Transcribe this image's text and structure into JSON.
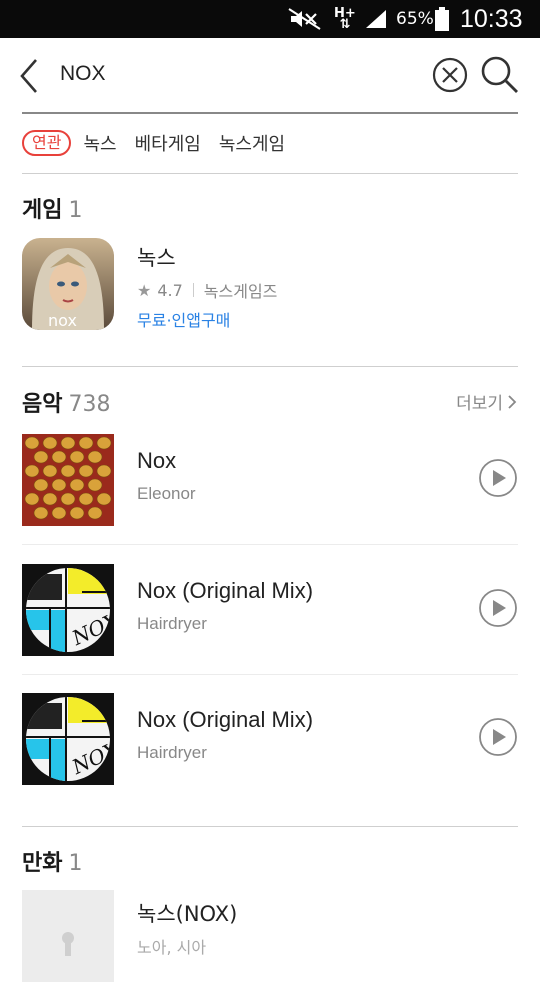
{
  "status_bar": {
    "network": "H+",
    "battery_percent": "65%",
    "time": "10:33"
  },
  "search": {
    "query": "NOX"
  },
  "related": {
    "badge": "연관",
    "tags": [
      "녹스",
      "베타게임",
      "녹스게임"
    ]
  },
  "games": {
    "title": "게임",
    "count": "1",
    "items": [
      {
        "title": "녹스",
        "rating": "4.7",
        "developer": "녹스게임즈",
        "price": "무료·인앱구매",
        "icon_text": "nox"
      }
    ]
  },
  "music": {
    "title": "음악",
    "count": "738",
    "more": "더보기",
    "items": [
      {
        "title": "Nox",
        "artist": "Eleonor"
      },
      {
        "title": "Nox (Original Mix)",
        "artist": "Hairdryer"
      },
      {
        "title": "Nox (Original Mix)",
        "artist": "Hairdryer"
      }
    ]
  },
  "comics": {
    "title": "만화",
    "count": "1",
    "items": [
      {
        "title": "녹스(NOX)",
        "author": "노아, 시아"
      }
    ]
  },
  "colors": {
    "accent_red": "#e8413b",
    "link_blue": "#2a82e4",
    "status_bar_bg": "#0a0a0a"
  },
  "icons": [
    "mute-icon",
    "signal-icon",
    "battery-icon",
    "back-icon",
    "clear-icon",
    "search-icon",
    "star-icon",
    "chevron-right-icon",
    "play-icon",
    "placeholder-icon"
  ]
}
